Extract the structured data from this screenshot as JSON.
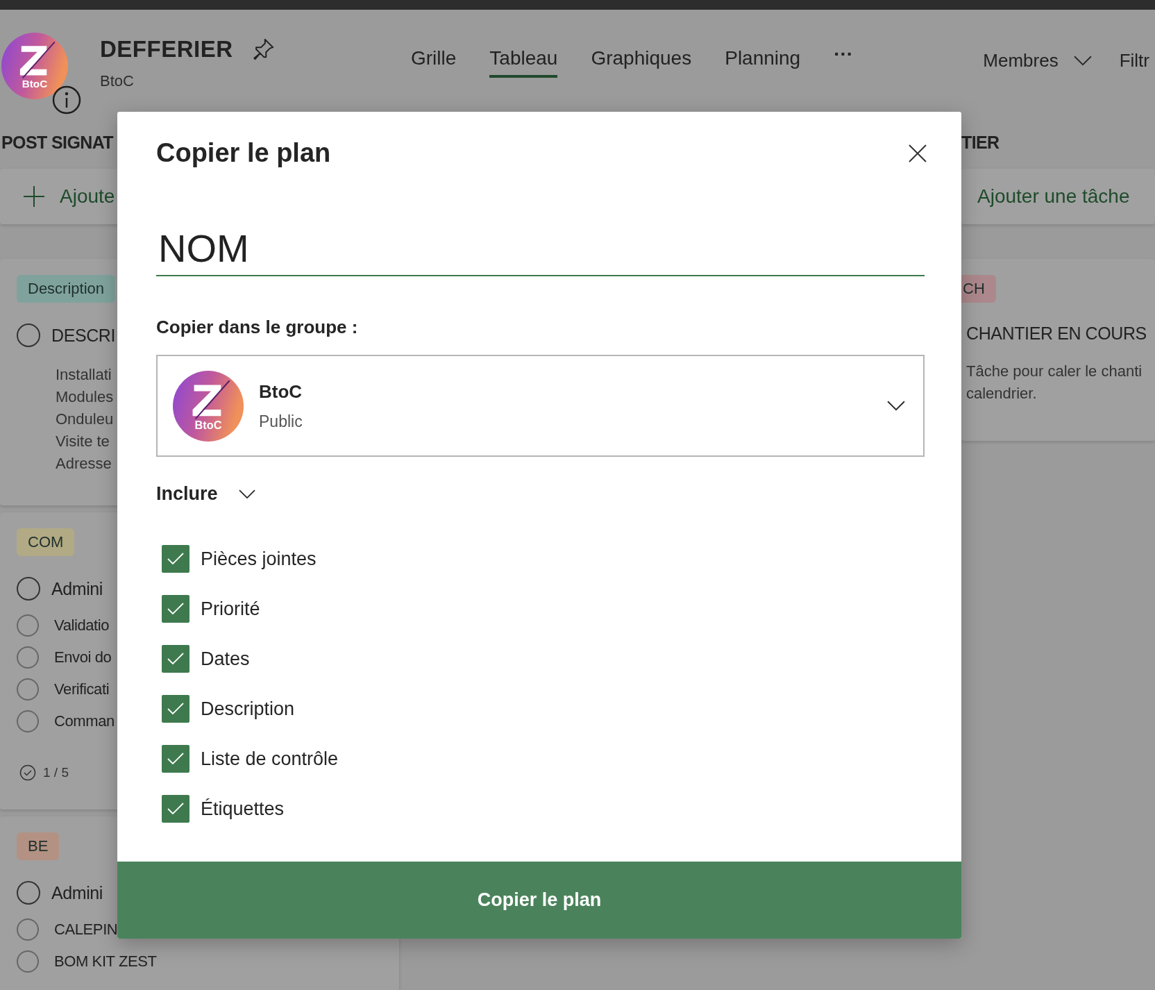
{
  "plan": {
    "title": "DEFFERIER",
    "group": "BtoC",
    "avatar_label": "BtoC"
  },
  "tabs": [
    {
      "label": "Grille",
      "selected": false
    },
    {
      "label": "Tableau",
      "selected": true
    },
    {
      "label": "Graphiques",
      "selected": false
    },
    {
      "label": "Planning",
      "selected": false
    }
  ],
  "more": "···",
  "members": "Membres",
  "filter": "Filtr",
  "left_column": {
    "title": "POST SIGNAT",
    "add_task": "Ajoute",
    "cards": [
      {
        "tag": "Description",
        "color": "#7fa39c",
        "title": "DESCRI",
        "checked": false,
        "lines": [
          "Installati",
          "Modules",
          "Onduleu",
          "Visite te",
          "Adresse"
        ]
      },
      {
        "tag": "COM",
        "color": "#b1aa84",
        "title": "Admini",
        "checked": false,
        "subtasks": [
          {
            "label": "Validatio",
            "checked": false
          },
          {
            "label": "Envoi do",
            "checked": false
          },
          {
            "label": "Verificati",
            "checked": false
          },
          {
            "label": "Comman",
            "checked": false
          }
        ],
        "progress": "1 / 5"
      },
      {
        "tag": "BE",
        "color": "#b39283",
        "title": "Admini",
        "checked": false,
        "subtasks": [
          {
            "label": "CALEPIN",
            "checked": false
          },
          {
            "label": "BOM KIT ZEST",
            "checked": false
          }
        ]
      }
    ]
  },
  "right_column": {
    "title": "TIER",
    "add_task": "Ajouter une tâche",
    "cards": [
      {
        "tag": "CH",
        "color": "#ac878b",
        "title": "CHANTIER EN COURS",
        "lines": [
          "Tâche pour caler le chanti",
          "calendrier."
        ]
      }
    ]
  },
  "dialog": {
    "title": "Copier le plan",
    "name": "NOM",
    "group_label": "Copier dans le groupe :",
    "group": {
      "avatar_label": "BtoC",
      "name": "BtoC",
      "visibility": "Public"
    },
    "include_label": "Inclure",
    "options": [
      {
        "label": "Pièces jointes",
        "checked": true
      },
      {
        "label": "Priorité",
        "checked": true
      },
      {
        "label": "Dates",
        "checked": true
      },
      {
        "label": "Description",
        "checked": true
      },
      {
        "label": "Liste de contrôle",
        "checked": true
      },
      {
        "label": "Étiquettes",
        "checked": true
      }
    ],
    "submit": "Copier le plan"
  }
}
